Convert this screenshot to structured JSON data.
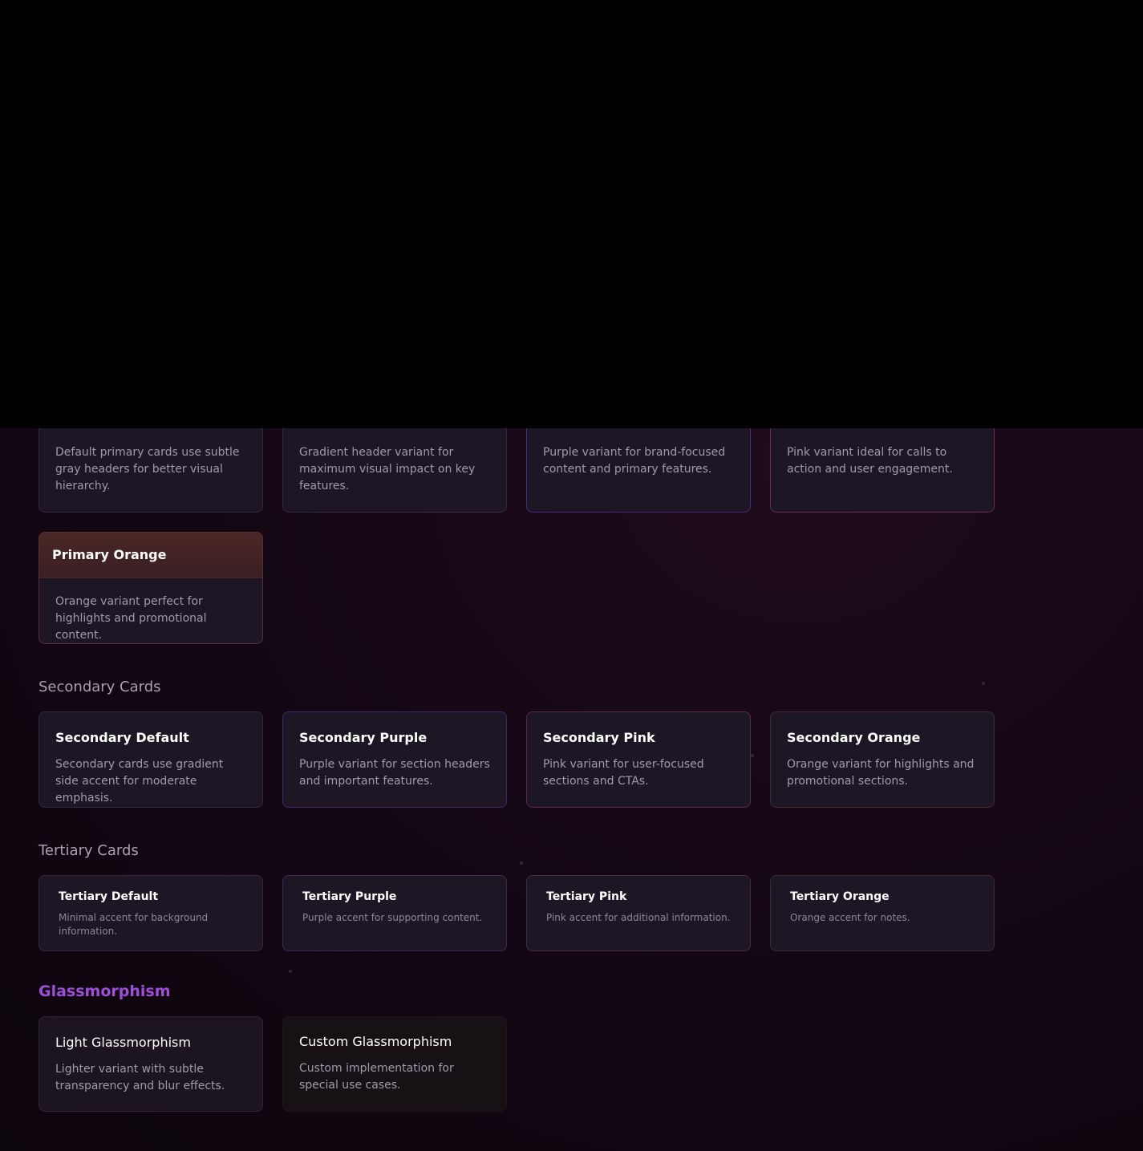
{
  "primary": {
    "default_desc": "Default primary cards use subtle gray headers for better visual hierarchy.",
    "gradient_desc": "Gradient header variant for maximum visual impact on key features.",
    "purple_desc": "Purple variant for brand-focused content and primary features.",
    "pink_desc": "Pink variant ideal for calls to action and user engagement.",
    "orange_title": "Primary Orange",
    "orange_desc": "Orange variant perfect for highlights and promotional content."
  },
  "secondary": {
    "section_title": "Secondary Cards",
    "cards": [
      {
        "title": "Secondary Default",
        "desc": "Secondary cards use gradient side accent for moderate emphasis."
      },
      {
        "title": "Secondary Purple",
        "desc": "Purple variant for section headers and important features."
      },
      {
        "title": "Secondary Pink",
        "desc": "Pink variant for user-focused sections and CTAs."
      },
      {
        "title": "Secondary Orange",
        "desc": "Orange variant for highlights and promotional sections."
      }
    ]
  },
  "tertiary": {
    "section_title": "Tertiary Cards",
    "cards": [
      {
        "title": "Tertiary Default",
        "desc": "Minimal accent for background information."
      },
      {
        "title": "Tertiary Purple",
        "desc": "Purple accent for supporting content."
      },
      {
        "title": "Tertiary Pink",
        "desc": "Pink accent for additional information."
      },
      {
        "title": "Tertiary Orange",
        "desc": "Orange accent for notes."
      }
    ]
  },
  "glass": {
    "section_title": "Glassmorphism",
    "cards": [
      {
        "title": "Light Glassmorphism",
        "desc": "Lighter variant with subtle transparency and blur effects."
      },
      {
        "title": "Custom Glassmorphism",
        "desc": "Custom implementation for special use cases."
      }
    ]
  },
  "colors": {
    "accent_purple": "#9d4fd8",
    "border_purple": "#4b2a7a",
    "border_pink": "#6a2a4f",
    "border_orange": "#5a2e32",
    "page_bg": "#130713",
    "card_bg": "#1d1624"
  }
}
